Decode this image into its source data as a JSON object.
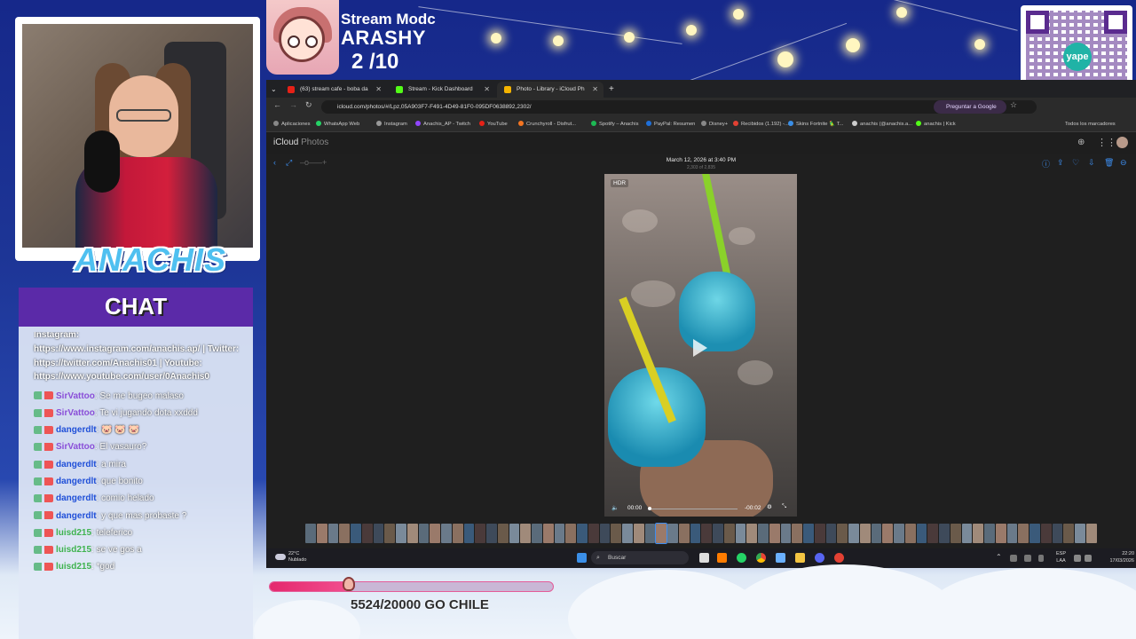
{
  "overlay": {
    "stream_title": "Stream Modc",
    "stream_name": "ARASHY",
    "stream_count": "2 /10",
    "streamer_name": "ANACHIS",
    "qr_logo": "yape",
    "goal_text": "5524/20000 GO CHILE",
    "goal_progress": 0.2762
  },
  "chat": {
    "title": "CHAT",
    "info_lines": [
      "Instagram:",
      "https://www.instagram.com/anachis.ap/ | Twitter:",
      "https://twitter.com/Anachis01 | Youtube:",
      "https://www.youtube.com/user/0Anachis0"
    ],
    "messages": [
      {
        "user": "SirVattoo",
        "color": "#8a4fd8",
        "text": ": Se me bugeo malaso"
      },
      {
        "user": "SirVattoo",
        "color": "#8a4fd8",
        "text": ": Te vi jugando dota xxddd"
      },
      {
        "user": "dangerdlt",
        "color": "#1f4fd8",
        "text": ": 🐷 🐷 🐷"
      },
      {
        "user": "SirVattoo",
        "color": "#8a4fd8",
        "text": ": El vasauro?"
      },
      {
        "user": "dangerdlt",
        "color": "#1f4fd8",
        "text": ": a mira"
      },
      {
        "user": "dangerdlt",
        "color": "#1f4fd8",
        "text": ": que bonito"
      },
      {
        "user": "dangerdlt",
        "color": "#1f4fd8",
        "text": ": comio helado"
      },
      {
        "user": "dangerdlt",
        "color": "#1f4fd8",
        "text": ": y que mas probaste ?"
      },
      {
        "user": "luisd215",
        "color": "#3fb34f",
        "text": ": teleferico"
      },
      {
        "user": "luisd215",
        "color": "#3fb34f",
        "text": ": se ve gos a"
      },
      {
        "user": "luisd215",
        "color": "#3fb34f",
        "text": ": *god"
      }
    ]
  },
  "browser": {
    "tabs": [
      {
        "label": "(63) stream cafe - boba da",
        "icon_color": "#e62117"
      },
      {
        "label": "Stream - Kick Dashboard",
        "icon_color": "#53fc18"
      },
      {
        "label": "Photo - Library - iCloud Ph",
        "icon_color": "#f5b400"
      }
    ],
    "url": "icloud.com/photos/#/Lpz,05A903F7-F491-4D49-81F0-095DF0638892,2302/",
    "ask_google": "Preguntar a Google",
    "bookmarks": [
      {
        "label": "Aplicaciones",
        "color": "#888"
      },
      {
        "label": "WhatsApp Web",
        "color": "#25d366"
      },
      {
        "label": "Instagram",
        "color": "#999"
      },
      {
        "label": "Anachis_AP - Twitch",
        "color": "#9146ff"
      },
      {
        "label": "YouTube",
        "color": "#e62117"
      },
      {
        "label": "Crunchyroll - Disfrut...",
        "color": "#f47521"
      },
      {
        "label": "Spotify – Anachis",
        "color": "#1db954"
      },
      {
        "label": "PayPal: Resumen",
        "color": "#1e6fd9"
      },
      {
        "label": "Disney+",
        "color": "#888"
      },
      {
        "label": "Recibidos (1.192) -...",
        "color": "#e34133"
      },
      {
        "label": "Skins Fortnite 🦜 T...",
        "color": "#3a8ee6"
      },
      {
        "label": "anachis (@anachis.a...",
        "color": "#ccc"
      },
      {
        "label": "anachis | Kick",
        "color": "#53fc18"
      }
    ],
    "all_bookmarks": "Todos los marcadores"
  },
  "icloud": {
    "brand": "iCloud",
    "section": "Photos",
    "photo_date": "March 12, 2026 at 3:40 PM",
    "photo_count": "2,303 of 2,835",
    "hdr_label": "HDR",
    "time_current": "00:00",
    "time_remaining": "-00:02"
  },
  "taskbar": {
    "temp": "22°C",
    "weather": "Nublado",
    "search": "Buscar",
    "lang1": "ESP",
    "lang2": "LAA",
    "time": "22:20",
    "date": "17/03/2026"
  }
}
